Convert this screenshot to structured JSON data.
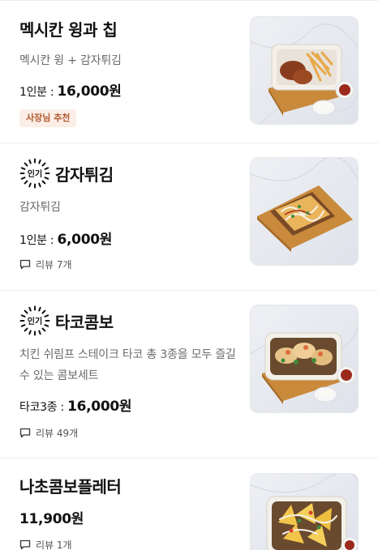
{
  "items": [
    {
      "name": "멕시칸 윙과 칩",
      "description": "멕시칸 윙 + 감자튀김",
      "price_prefix": "1인분 : ",
      "price": "16,000원",
      "badge": "사장님 추천"
    },
    {
      "popular_label": "인기",
      "name": "감자튀김",
      "description": "감자튀김",
      "price_prefix": "1인분 : ",
      "price": "6,000원",
      "review": "리뷰 7개"
    },
    {
      "popular_label": "인기",
      "name": "타코콤보",
      "description": "치킨 쉬림프 스테이크 타코 총 3종을 모두 즐길수 있는 콤보세트",
      "price_prefix": "타코3종 : ",
      "price": "16,000원",
      "review": "리뷰 49개"
    },
    {
      "name": "나초콤보플레터",
      "price": "11,900원",
      "review": "리뷰 1개"
    }
  ],
  "colors": {
    "badge_bg": "#fbeee6",
    "badge_text": "#b25a32",
    "separator": "#ececec",
    "description": "#6b6b6b"
  },
  "icons": {
    "popular": "popular-sunburst-icon",
    "review": "speech-bubble-icon"
  }
}
